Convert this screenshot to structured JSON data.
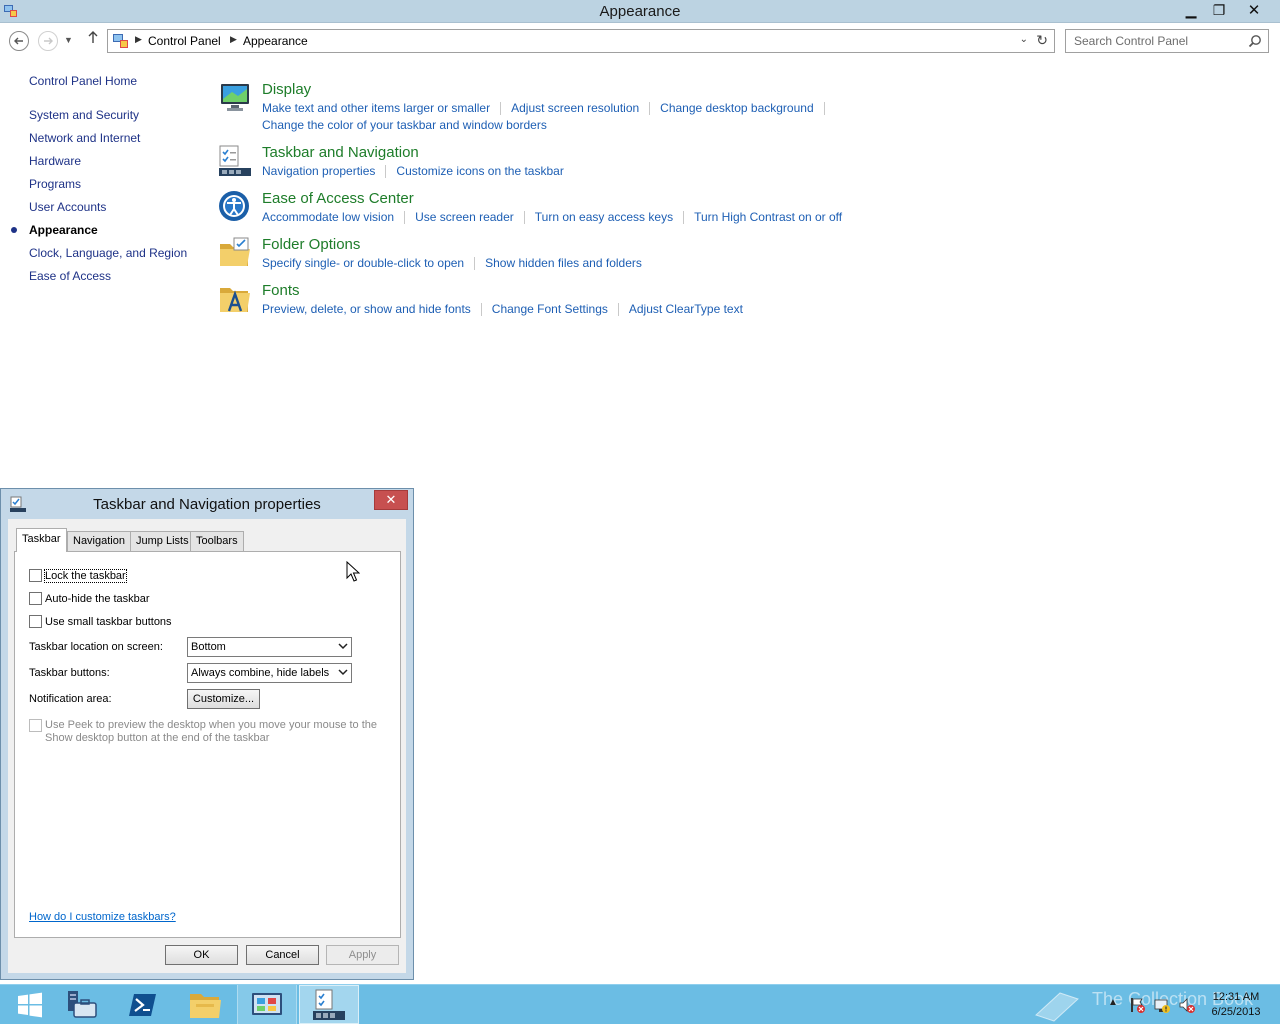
{
  "window": {
    "title": "Appearance",
    "min_glyph": "▁",
    "max_glyph": "❐",
    "close_glyph": "✕"
  },
  "address": {
    "crumbs": [
      "Control Panel",
      "Appearance"
    ]
  },
  "search": {
    "placeholder": "Search Control Panel"
  },
  "sidebar": {
    "home": "Control Panel Home",
    "items": [
      "System and Security",
      "Network and Internet",
      "Hardware",
      "Programs",
      "User Accounts",
      "Appearance",
      "Clock, Language, and Region",
      "Ease of Access"
    ],
    "current": "Appearance"
  },
  "categories": [
    {
      "title": "Display",
      "icon": "display-icon",
      "links": [
        "Make text and other items larger or smaller",
        "Adjust screen resolution",
        "Change desktop background",
        "Change the color of your taskbar and window borders"
      ]
    },
    {
      "title": "Taskbar and Navigation",
      "icon": "taskbar-icon",
      "links": [
        "Navigation properties",
        "Customize icons on the taskbar"
      ]
    },
    {
      "title": "Ease of Access Center",
      "icon": "ease-of-access-icon",
      "links": [
        "Accommodate low vision",
        "Use screen reader",
        "Turn on easy access keys",
        "Turn High Contrast on or off"
      ]
    },
    {
      "title": "Folder Options",
      "icon": "folder-icon",
      "links": [
        "Specify single- or double-click to open",
        "Show hidden files and folders"
      ]
    },
    {
      "title": "Fonts",
      "icon": "fonts-icon",
      "links": [
        "Preview, delete, or show and hide fonts",
        "Change Font Settings",
        "Adjust ClearType text"
      ]
    }
  ],
  "dialog": {
    "title": "Taskbar and Navigation properties",
    "close_glyph": "✕",
    "tabs": [
      "Taskbar",
      "Navigation",
      "Jump Lists",
      "Toolbars"
    ],
    "active_tab": "Taskbar",
    "checkboxes": {
      "lock": {
        "label": "Lock the taskbar",
        "checked": false
      },
      "autohide": {
        "label": "Auto-hide the taskbar",
        "checked": false
      },
      "small": {
        "label": "Use small taskbar buttons",
        "checked": false
      }
    },
    "location_label": "Taskbar location on screen:",
    "location_value": "Bottom",
    "buttons_label": "Taskbar buttons:",
    "buttons_value": "Always combine, hide labels",
    "notification_label": "Notification area:",
    "customize_label": "Customize...",
    "peek_label": "Use Peek to preview the desktop when you move your mouse to the Show desktop button at the end of the taskbar",
    "help_link": "How do I customize taskbars?",
    "ok_label": "OK",
    "cancel_label": "Cancel",
    "apply_label": "Apply"
  },
  "taskbar": {
    "items": [
      "start-icon",
      "server-manager-icon",
      "powershell-icon",
      "file-explorer-icon",
      "control-panel-icon",
      "taskbar-properties-icon"
    ],
    "watermark": "The Collection Book",
    "clock_time": "12:31 AM",
    "clock_date": "6/25/2013"
  },
  "colors": {
    "titlebar": "#bcd3e2",
    "link_blue": "#1e5fb4",
    "category_green": "#1e7d2a",
    "sidebar_blue": "#1e3287",
    "taskbar": "#6bbde4",
    "dialog_frame": "#c4d8e8",
    "close_red": "#c75050"
  }
}
